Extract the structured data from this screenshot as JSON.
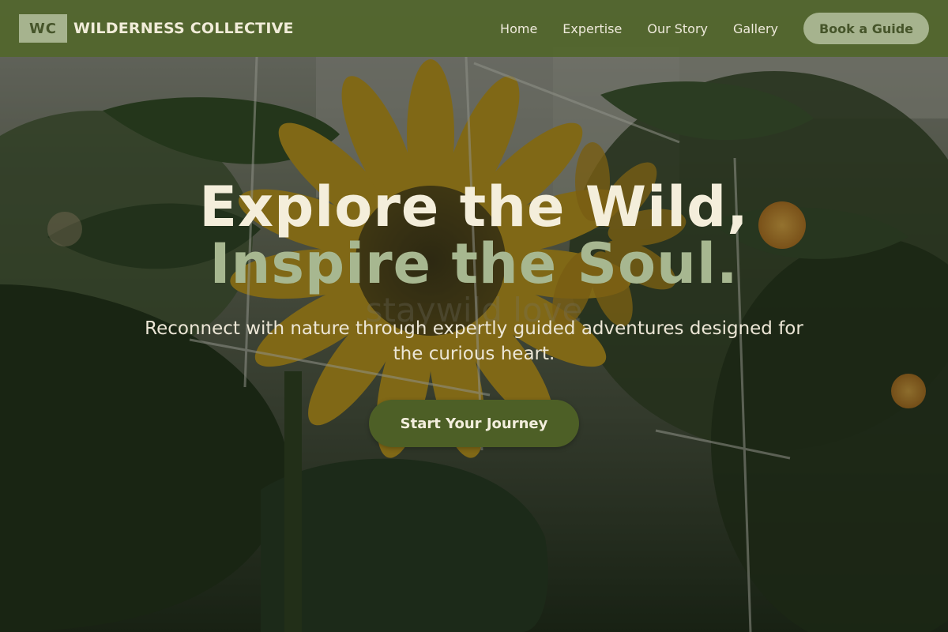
{
  "brand": {
    "logo_initials": "WC",
    "name": "WILDERNESS COLLECTIVE"
  },
  "nav": {
    "links": [
      {
        "label": "Home"
      },
      {
        "label": "Expertise"
      },
      {
        "label": "Our Story"
      },
      {
        "label": "Gallery"
      }
    ],
    "cta_label": "Book a Guide"
  },
  "hero": {
    "headline_line1": "Explore the Wild,",
    "headline_line2": "Inspire the Soul.",
    "watermark": "staywild love",
    "subtitle": "Reconnect with nature through expertly guided adventures designed for the curious heart.",
    "cta_label": "Start Your Journey",
    "background_image": "sunflower-garden-photo"
  },
  "colors": {
    "nav_background": "#52662c",
    "accent_sage": "#a6b38e",
    "accent_olive": "#4d5f26",
    "text_cream": "#f4eedb"
  }
}
